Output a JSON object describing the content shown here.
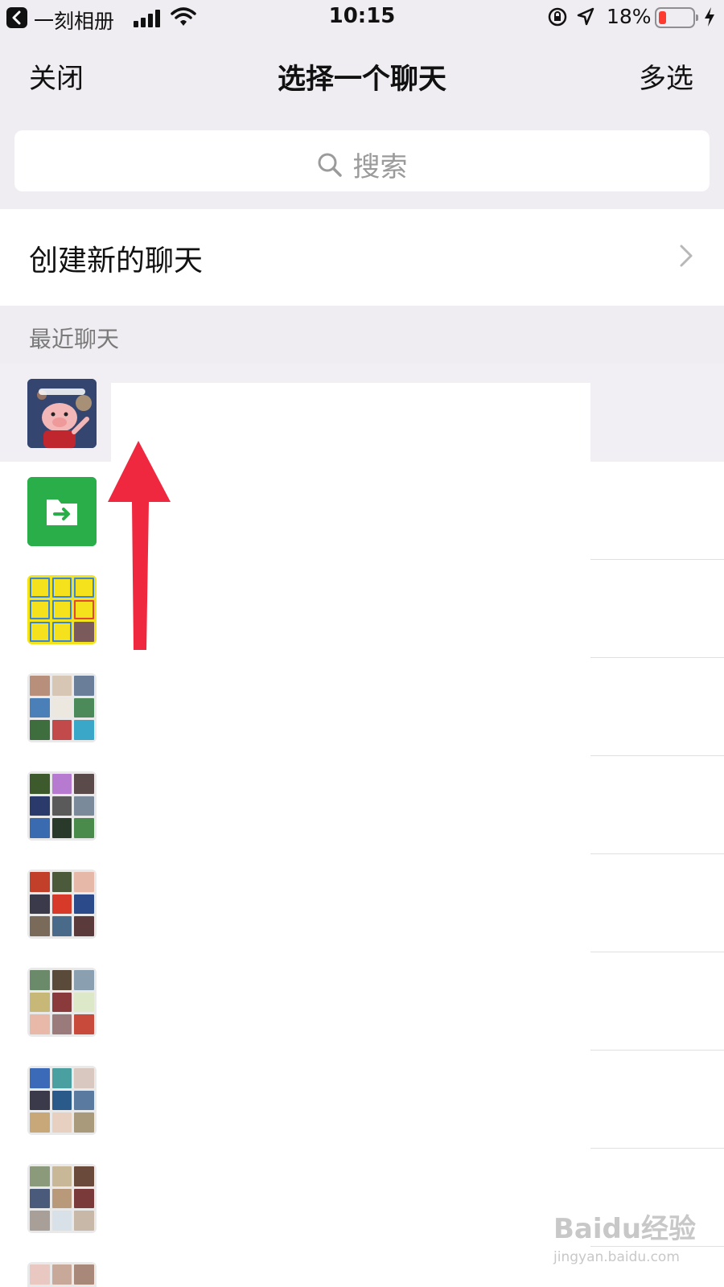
{
  "status_bar": {
    "back_app_label": "一刻相册",
    "time": "10:15",
    "battery_percent": "18%",
    "icons": [
      "back-app-icon",
      "signal-icon",
      "wifi-icon",
      "orientation-lock-icon",
      "location-icon",
      "battery-icon",
      "charging-icon"
    ]
  },
  "nav": {
    "close_label": "关闭",
    "title": "选择一个聊天",
    "multi_select_label": "多选"
  },
  "search": {
    "placeholder": "搜索"
  },
  "create_chat": {
    "label": "创建新的聊天"
  },
  "section": {
    "recent_label": "最近聊天"
  },
  "recent_chats": [
    {
      "avatar": "pig-cartoon-avatar"
    },
    {
      "avatar": "file-transfer-icon"
    },
    {
      "avatar": "house-sticker-grid"
    },
    {
      "avatar": "group-photo-grid"
    },
    {
      "avatar": "group-photo-grid"
    },
    {
      "avatar": "group-photo-grid"
    },
    {
      "avatar": "group-photo-grid"
    },
    {
      "avatar": "group-photo-grid"
    },
    {
      "avatar": "group-photo-grid"
    },
    {
      "avatar": "group-photo-grid"
    }
  ],
  "annotation": {
    "arrow_color": "#f0283f"
  },
  "watermark": {
    "brand": "Baidu经验",
    "url": "jingyan.baidu.com"
  },
  "colors": {
    "nav_bg": "#efedf1",
    "file_transfer_green": "#2aae4a",
    "battery_low_red": "#ff3b30"
  }
}
